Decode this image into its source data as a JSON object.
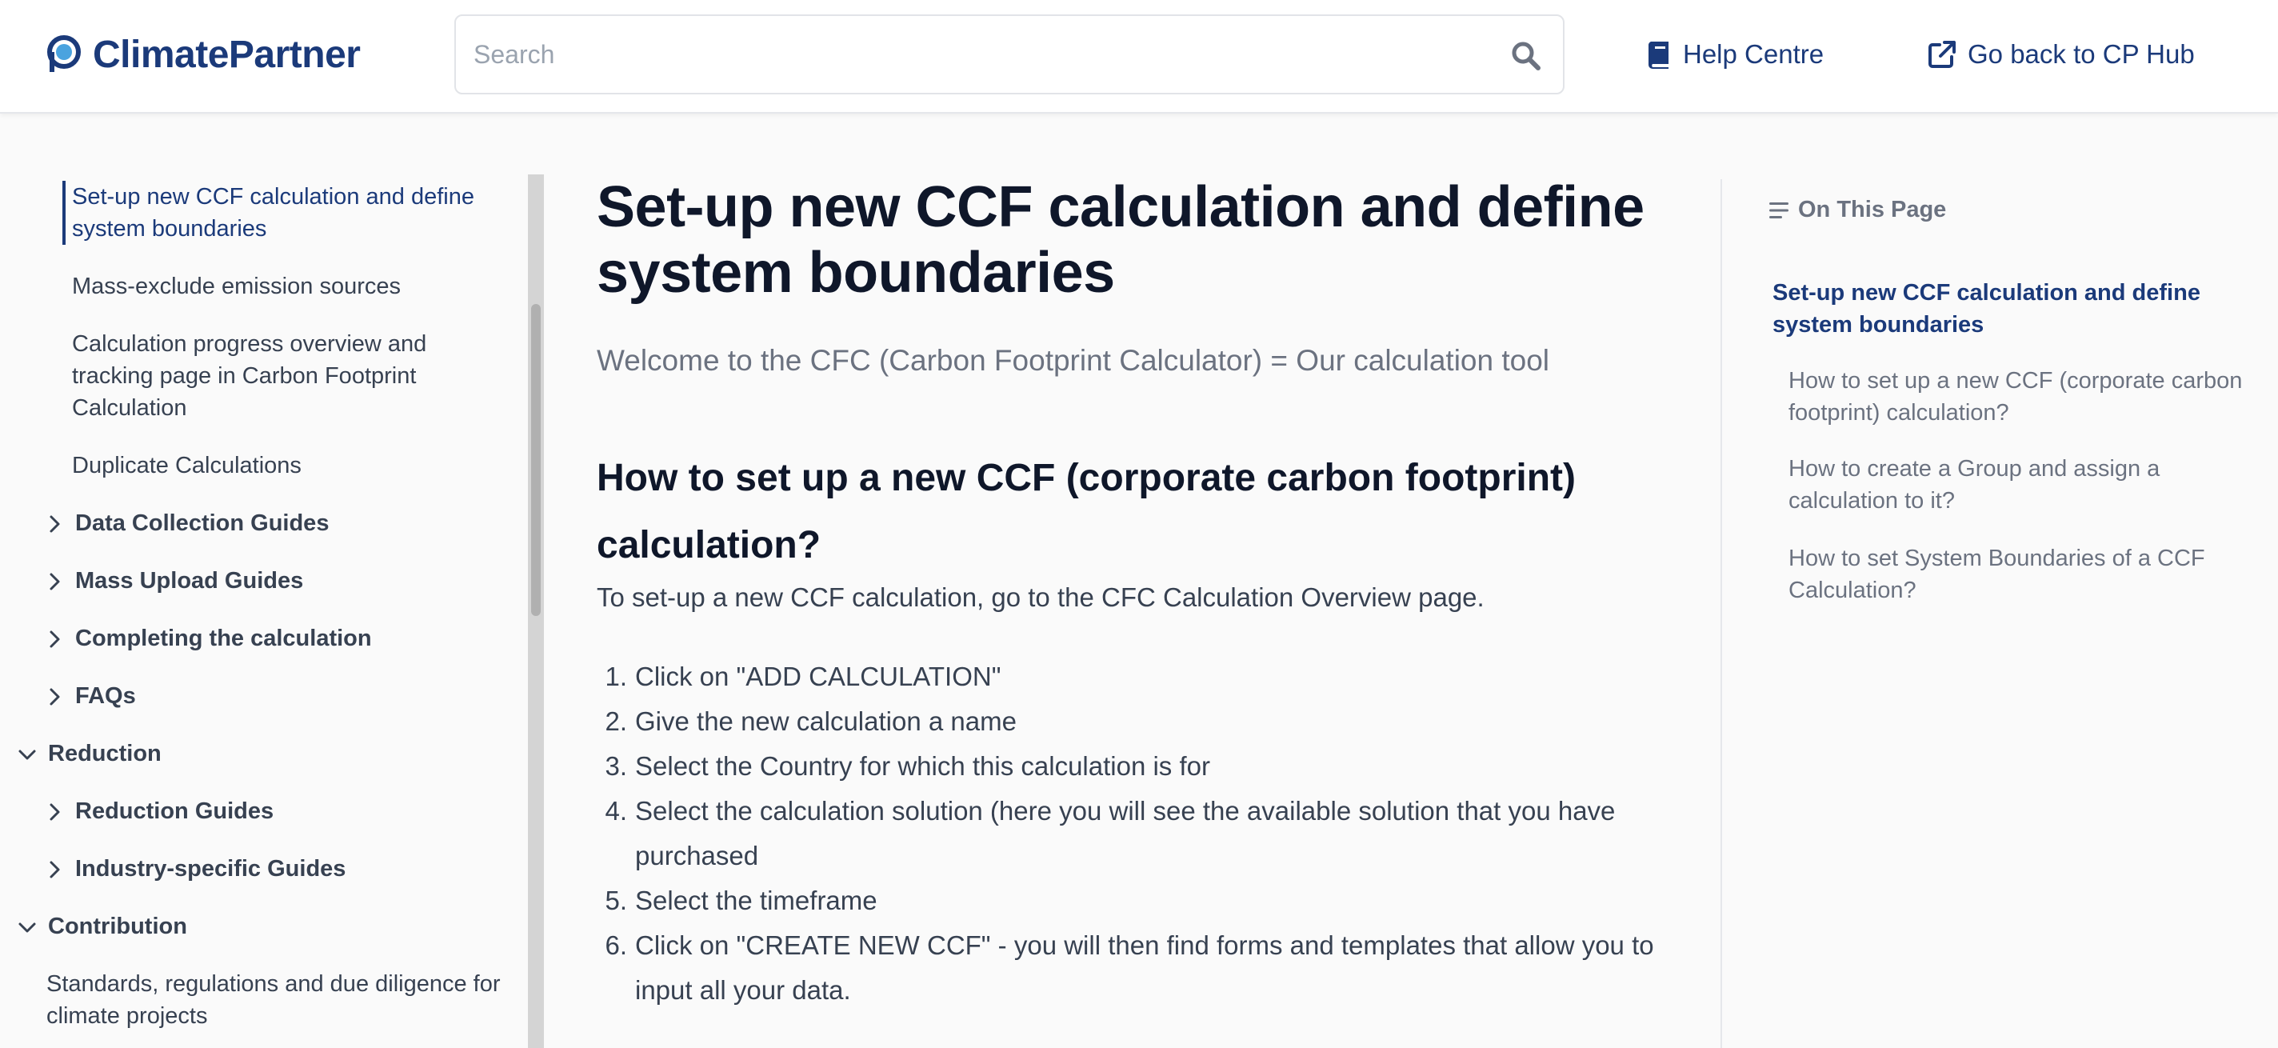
{
  "header": {
    "logo_text": "ClimatePartner",
    "search_placeholder": "Search",
    "help_label": "Help Centre",
    "goback_label": "Go back to CP Hub"
  },
  "sidebar": {
    "items": [
      {
        "label": "Set-up new CCF calculation and define system boundaries",
        "state": "active"
      },
      {
        "label": "Mass-exclude emission sources"
      },
      {
        "label": "Calculation progress overview and tracking page in Carbon Footprint Calculation"
      },
      {
        "label": "Duplicate Calculations"
      },
      {
        "label": "Data Collection Guides",
        "state": "collapsed"
      },
      {
        "label": "Mass Upload Guides",
        "state": "collapsed"
      },
      {
        "label": "Completing the calculation",
        "state": "collapsed"
      },
      {
        "label": "FAQs",
        "state": "collapsed"
      },
      {
        "label": "Reduction",
        "state": "expanded"
      },
      {
        "label": "Reduction Guides",
        "state": "collapsed"
      },
      {
        "label": "Industry-specific Guides",
        "state": "collapsed"
      },
      {
        "label": "Contribution",
        "state": "expanded"
      },
      {
        "label": "Standards, regulations and due diligence for climate projects"
      }
    ]
  },
  "main": {
    "title": "Set-up new CCF calculation and define system boundaries",
    "subtitle": "Welcome to the CFC (Carbon Footprint Calculator) = Our calculation tool",
    "h2": "How to set up a new CCF (corporate carbon footprint) calculation?",
    "intro": "To set-up a new CCF calculation, go to the CFC Calculation Overview page.",
    "steps": [
      {
        "num": "1.",
        "text": "Click on \"ADD CALCULATION\""
      },
      {
        "num": "2.",
        "text": "Give the new calculation a name"
      },
      {
        "num": "3.",
        "text": "Select the Country for which this calculation is for"
      },
      {
        "num": "4.",
        "text": "Select the calculation solution (here you will see the available solution that you have purchased"
      },
      {
        "num": "5.",
        "text": "Select the timeframe"
      },
      {
        "num": "6.",
        "text": "Click on \"CREATE NEW CCF\" - you will then find forms and templates that allow you to input all your data."
      }
    ]
  },
  "toc": {
    "heading": "On This Page",
    "items": [
      {
        "label": "Set-up new CCF calculation and define system boundaries",
        "active": true
      },
      {
        "label": "How to set up a new CCF (corporate carbon footprint) calculation?"
      },
      {
        "label": "How to create a Group and assign a calculation to it?"
      },
      {
        "label": "How to set System Boundaries of a CCF Calculation?"
      }
    ]
  },
  "colors": {
    "brand": "#1b3a7a",
    "text_muted": "#6b7280",
    "logo_accent": "#4aa3df"
  },
  "icons": [
    "logo-mark-icon",
    "search-icon",
    "book-icon",
    "external-link-icon",
    "chevron-right-icon",
    "chevron-down-icon",
    "list-icon"
  ]
}
